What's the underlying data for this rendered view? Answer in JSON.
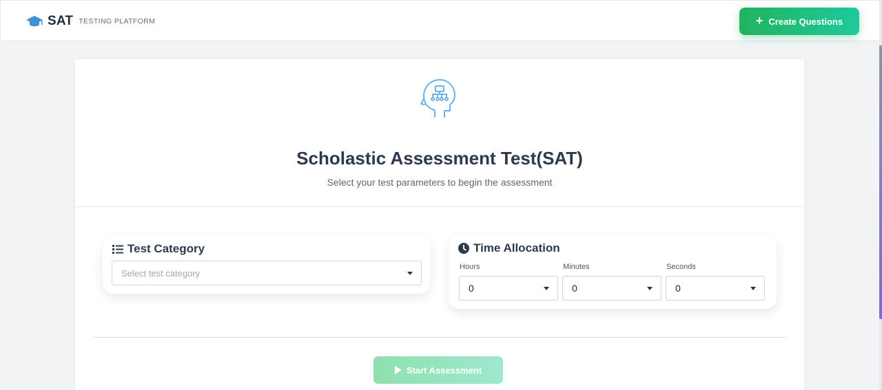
{
  "header": {
    "brand_title": "SAT",
    "brand_subtitle": "TESTING PLATFORM",
    "brand_icon": "graduation-cap-icon",
    "create_button_label": "Create Questions",
    "create_button_icon": "plus-icon"
  },
  "main": {
    "hero_icon": "brain-network-icon",
    "title": "Scholastic Assessment Test(SAT)",
    "subtitle": "Select your test parameters to begin the assessment",
    "category": {
      "heading": "Test Category",
      "icon": "list-icon",
      "placeholder": "Select test category"
    },
    "time": {
      "heading": "Time Allocation",
      "icon": "clock-icon",
      "hours_label": "Hours",
      "minutes_label": "Minutes",
      "seconds_label": "Seconds",
      "hours_value": "0",
      "minutes_value": "0",
      "seconds_value": "0"
    },
    "start_button_label": "Start Assessment",
    "start_button_icon": "play-icon"
  },
  "colors": {
    "accent_green": "#22b35e",
    "accent_teal": "#1ec99c",
    "brand_blue": "#3f8fd6",
    "hero_icon_blue": "#6bb2ea"
  }
}
